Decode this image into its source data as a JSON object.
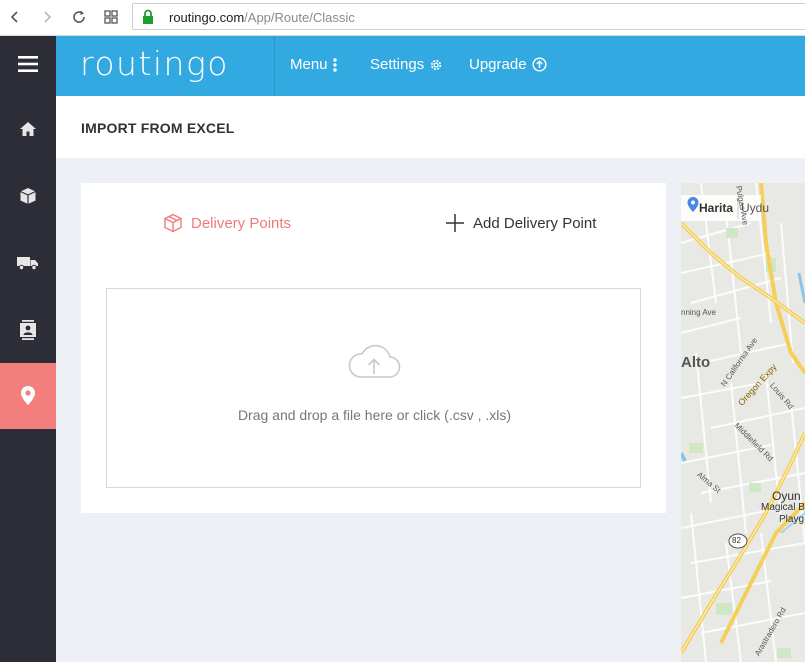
{
  "browser": {
    "url_host": "routingo.com",
    "url_path": "/App/Route/Classic"
  },
  "header": {
    "logo": "routingo",
    "menu": [
      {
        "label": "Menu",
        "icon": "kebab-icon"
      },
      {
        "label": "Settings",
        "icon": "gear-icon"
      },
      {
        "label": "Upgrade",
        "icon": "upgrade-arrow-icon"
      }
    ]
  },
  "sidebar": {
    "items": [
      {
        "name": "menu-toggle",
        "icon": "hamburger-icon"
      },
      {
        "name": "home",
        "icon": "home-icon"
      },
      {
        "name": "packages",
        "icon": "box-icon"
      },
      {
        "name": "vehicles",
        "icon": "truck-icon"
      },
      {
        "name": "contacts",
        "icon": "contacts-icon"
      },
      {
        "name": "locations",
        "icon": "map-pin-icon",
        "active": true
      }
    ]
  },
  "page": {
    "title": "IMPORT FROM EXCEL"
  },
  "card": {
    "tabs": [
      {
        "label": "Delivery Points",
        "active": true
      },
      {
        "label": "Add Delivery Point",
        "active": false
      }
    ],
    "dropzone_text": "Drag and drop a file here or click (.csv , .xls)"
  },
  "map": {
    "labels": {
      "harita": "Harita",
      "uydu": "Uydu",
      "pulgas": "Pulgas Ave",
      "ninning": "nning Ave",
      "alto": "Alto",
      "california": "N California Ave",
      "oregon": "Oregon Expy",
      "louis": "Louis Rd",
      "middlefield": "Middlefield Rd",
      "alma": "Alma St",
      "oyun": "Oyun",
      "magical": "Magical B",
      "playg": "Playg",
      "route": "82",
      "arastradero": "Arastradero Rd"
    }
  },
  "colors": {
    "header": "#33a9e1",
    "sidebar": "#2c2d37",
    "active": "#f47e7e",
    "accent_text": "#f07a7a",
    "content_bg": "#edf0f4"
  }
}
